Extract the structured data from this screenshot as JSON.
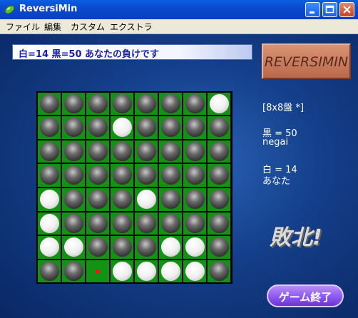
{
  "window": {
    "title": "ReversiMin"
  },
  "menu": [
    "ファイル",
    "編集",
    "カスタム",
    "エクストラ"
  ],
  "status": "白=14  黒=50  あなたの負けです",
  "logo": "REVERSIMIN",
  "info": {
    "board_size": "[8x8盤 *]",
    "black_line": "黒 = 50",
    "black_player": "negai",
    "white_line": "白 = 14",
    "white_player": "あなた"
  },
  "result": "敗北!",
  "end_button": "ゲーム終了",
  "board": {
    "rows": [
      "BBBBBBBW",
      "BBBWBBBB",
      "BBBBBBBB",
      "BBBBBBBB",
      "WBBBWBBB",
      "WBBBBBBB",
      "WWBBBWWB",
      "BB.WWWWB"
    ],
    "last_move_marker": {
      "row": 7,
      "col": 2
    }
  },
  "colors": {
    "board_green": "#139313",
    "status_text": "#1c20a0",
    "end_button": "#8d58f0"
  }
}
